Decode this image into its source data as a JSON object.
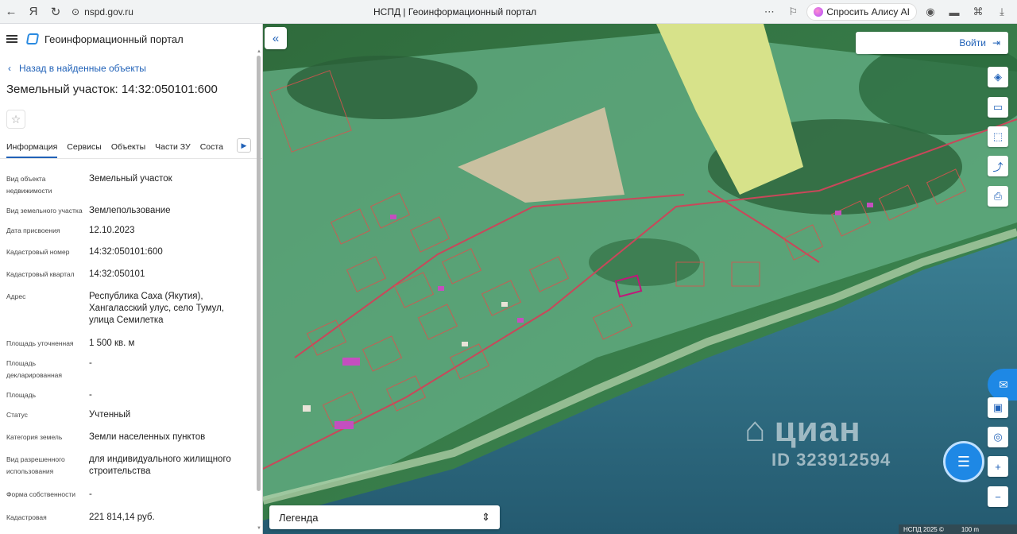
{
  "browser": {
    "url": "nspd.gov.ru",
    "tab_title": "НСПД | Геоинформационный портал",
    "alice_label": "Спросить Алису AI"
  },
  "header": {
    "portal_title": "Геоинформационный портал"
  },
  "panel": {
    "back_link": "Назад в найденные объекты",
    "title": "Земельный участок: 14:32:050101:600",
    "tabs": [
      "Информация",
      "Сервисы",
      "Объекты",
      "Части ЗУ",
      "Соста"
    ],
    "attributes": [
      {
        "label": "Вид объекта недвижимости",
        "value": "Земельный участок"
      },
      {
        "label": "Вид земельного участка",
        "value": "Землепользование"
      },
      {
        "label": "Дата присвоения",
        "value": "12.10.2023"
      },
      {
        "label": "Кадастровый номер",
        "value": "14:32:050101:600"
      },
      {
        "label": "Кадастровый квартал",
        "value": "14:32:050101"
      },
      {
        "label": "Адрес",
        "value": "Республика Саха (Якутия), Хангаласский улус, село Тумул, улица Семилетка"
      },
      {
        "label": "Площадь уточненная",
        "value": "1 500 кв. м"
      },
      {
        "label": "Площадь декларированная",
        "value": "-"
      },
      {
        "label": "Площадь",
        "value": "-"
      },
      {
        "label": "Статус",
        "value": "Учтенный"
      },
      {
        "label": "Категория земель",
        "value": "Земли населенных пунктов"
      },
      {
        "label": "Вид разрешенного использования",
        "value": "для индивидуального жилищного строительства"
      },
      {
        "label": "Форма собственности",
        "value": "-"
      },
      {
        "label": "Кадастровая",
        "value": "221 814,14 руб."
      }
    ]
  },
  "map": {
    "login_label": "Войти",
    "legend_label": "Легенда",
    "watermark_brand": "циан",
    "watermark_id": "ID 323912594",
    "attribution": "НСПД 2025 ©",
    "scale_label": "100 m",
    "colors": {
      "accent": "#2162b8",
      "river": "#2f6f86",
      "parcel_line": "#d9534f",
      "highlight": "#c0187a"
    }
  }
}
